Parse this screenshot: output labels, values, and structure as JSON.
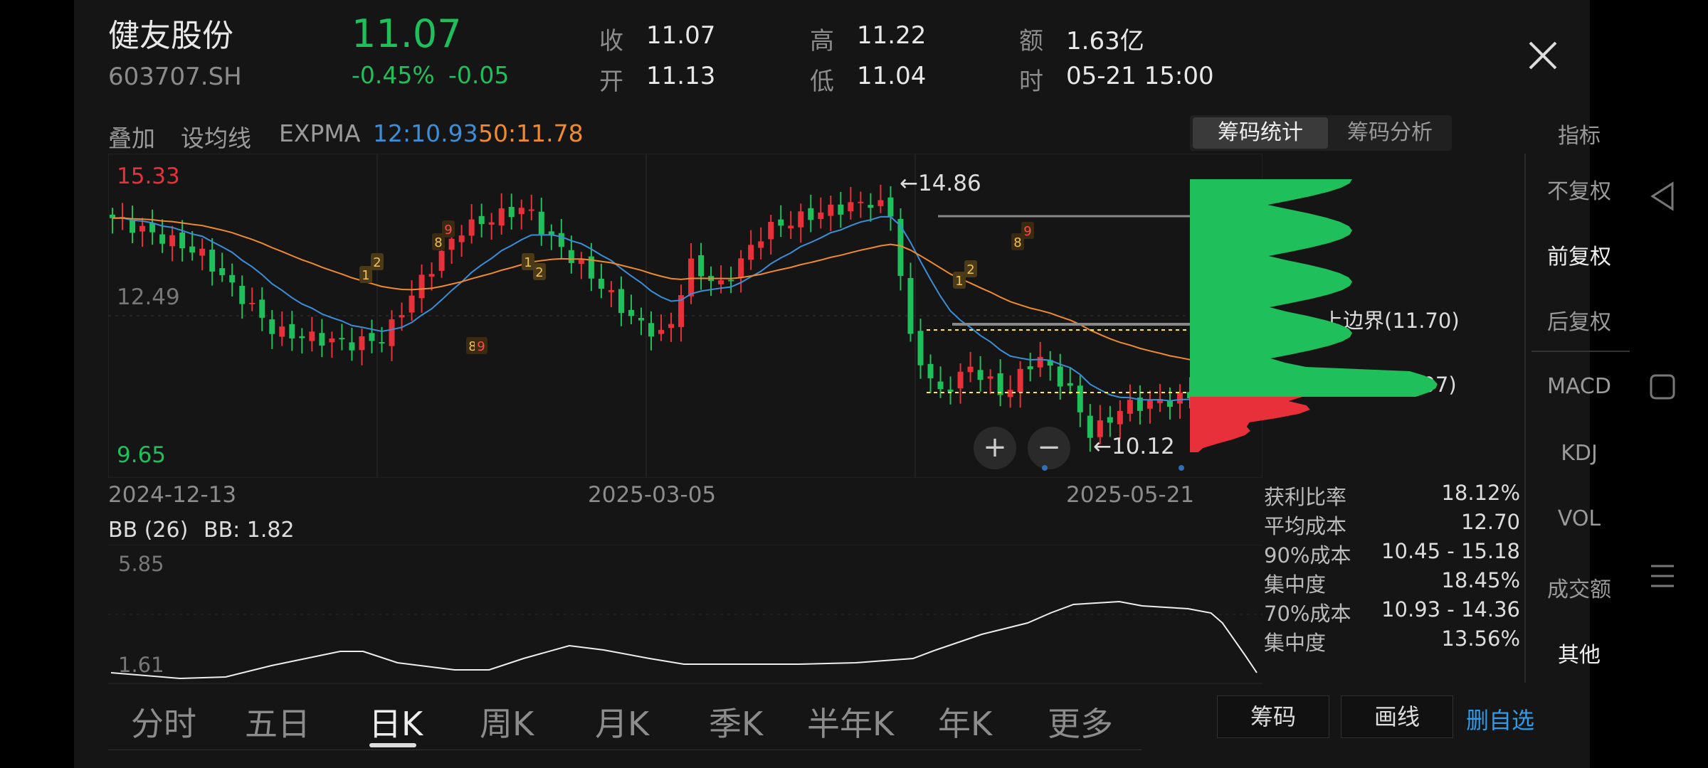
{
  "header": {
    "name": "健友股份",
    "code": "603707.SH",
    "price": "11.07",
    "change_pct": "-0.45%",
    "change": "-0.05",
    "quote": [
      {
        "label": "收",
        "value": "11.07"
      },
      {
        "label": "开",
        "value": "11.13"
      },
      {
        "label": "高",
        "value": "11.22"
      },
      {
        "label": "低",
        "value": "11.04"
      },
      {
        "label": "额",
        "value": "1.63亿"
      },
      {
        "label": "时",
        "value": "05-21 15:00"
      }
    ]
  },
  "toolbar": {
    "overlay": "叠加",
    "set_ma": "设均线",
    "indicator": "EXPMA",
    "ma12": "12:10.93",
    "ma50": "50:11.78"
  },
  "chip_tabs": [
    "筹码统计",
    "筹码分析"
  ],
  "indicator_label": "指标",
  "kline": {
    "y_top": "15.33",
    "y_mid": "12.49",
    "y_bottom": "9.65",
    "high_mark": "14.86",
    "low_mark": "10.12",
    "x_labels": [
      "2024-12-13",
      "2025-03-05",
      "2025-05-21"
    ],
    "upper_bound_label": "上边界(11.70)",
    "peak_label": "筹码峰(11.07)",
    "sequence_marks": [
      "1",
      "2",
      "8",
      "9",
      "1",
      "2",
      "8",
      "9",
      "1",
      "2",
      "8",
      "9"
    ]
  },
  "zoom": {
    "plus": "+",
    "minus": "−"
  },
  "sub_chart": {
    "title": "BB (26)",
    "value": "BB: 1.82",
    "y_top": "5.85",
    "y_bottom": "1.61"
  },
  "chip_stats": [
    {
      "label": "获利比率",
      "value": "18.12%"
    },
    {
      "label": "平均成本",
      "value": "12.70"
    },
    {
      "label": "90%成本",
      "value": "10.45 - 15.18"
    },
    {
      "label": "集中度",
      "value": "18.45%"
    },
    {
      "label": "70%成本",
      "value": "10.93 - 14.36"
    },
    {
      "label": "集中度",
      "value": "13.56%"
    }
  ],
  "right_menu": [
    "不复权",
    "前复权",
    "后复权",
    "MACD",
    "KDJ",
    "VOL",
    "成交额",
    "其他"
  ],
  "period_tabs": [
    "分时",
    "五日",
    "日K",
    "周K",
    "月K",
    "季K",
    "半年K",
    "年K",
    "更多"
  ],
  "bottom_buttons": {
    "chip": "筹码",
    "draw": "画线",
    "remove": "删自选"
  },
  "colors": {
    "up": "#e8303a",
    "down": "#1fbf5c",
    "ma12": "#3a8fd8",
    "ma50": "#f08a2c",
    "accent": "#2f9be8"
  },
  "chart_data": {
    "type": "candlestick",
    "close_last": 11.07,
    "ylim": [
      9.65,
      15.33
    ],
    "chip_peak": 11.07,
    "upper_bound": 11.7,
    "high": 14.86,
    "low": 10.12,
    "bb_ylim": [
      1.61,
      5.85
    ],
    "bb_last": 1.82
  }
}
